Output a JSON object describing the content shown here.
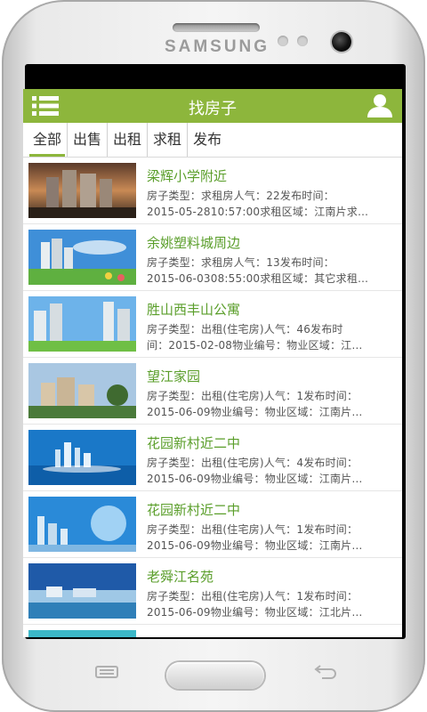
{
  "device": {
    "brand": "SAMSUNG"
  },
  "app": {
    "title": "找房子",
    "colors": {
      "accent": "#8db63c",
      "title_green": "#5a9e2a"
    },
    "icons": {
      "menu": "list-menu-icon",
      "user": "user-profile-icon"
    }
  },
  "tabs": [
    {
      "label": "全部",
      "active": true
    },
    {
      "label": "出售",
      "active": false
    },
    {
      "label": "出租",
      "active": false
    },
    {
      "label": "求租",
      "active": false
    },
    {
      "label": "发布",
      "active": false
    }
  ],
  "listings": [
    {
      "title": "梁辉小学附近",
      "line1": "房子类型：求租房人气：22发布时间：",
      "line2": "2015-05-2810:57:00求租区域：江南片求…"
    },
    {
      "title": "余姚塑料城周边",
      "line1": "房子类型：求租房人气：13发布时间：",
      "line2": "2015-06-0308:55:00求租区域：其它求租…"
    },
    {
      "title": "胜山西丰山公寓",
      "line1": "房子类型：出租(住宅房)人气：46发布时",
      "line2": "间：2015-02-08物业编号：物业区域：江…"
    },
    {
      "title": "望江家园",
      "line1": "房子类型：出租(住宅房)人气：1发布时间：",
      "line2": "2015-06-09物业编号：物业区域：江南片…"
    },
    {
      "title": "花园新村近二中",
      "line1": "房子类型：出租(住宅房)人气：4发布时间：",
      "line2": "2015-06-09物业编号：物业区域：江南片…"
    },
    {
      "title": "花园新村近二中",
      "line1": "房子类型：出租(住宅房)人气：1发布时间：",
      "line2": "2015-06-09物业编号：物业区域：江南片…"
    },
    {
      "title": "老舜江名苑",
      "line1": "房子类型：出租(住宅房)人气：1发布时间：",
      "line2": "2015-06-09物业编号：物业区域：江北片…"
    },
    {
      "title": "",
      "line1": "",
      "line2": ""
    }
  ]
}
